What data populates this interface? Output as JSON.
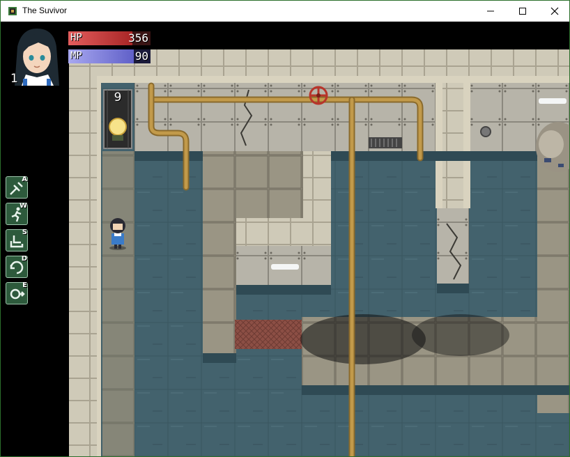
{
  "window": {
    "title": "The Suvivor",
    "controls": [
      "minimize-icon",
      "maximize-icon",
      "close-icon"
    ]
  },
  "hud": {
    "level": "1",
    "hp": {
      "label": "HP",
      "value": "356",
      "fraction": 0.78
    },
    "mp": {
      "label": "MP",
      "value": "90",
      "fraction": 0.8
    }
  },
  "skills": [
    {
      "key": "A",
      "icon": "attack-skill-icon"
    },
    {
      "key": "W",
      "icon": "walk-run-skill-icon"
    },
    {
      "key": "S",
      "icon": "use-skill-icon"
    },
    {
      "key": "D",
      "icon": "cycle-skill-icon"
    },
    {
      "key": "E",
      "icon": "equip-skill-icon"
    }
  ],
  "item_counter": {
    "count": "9",
    "icon": "flashlight-bulb-icon"
  },
  "colors": {
    "hp_bar": "#c93a3a",
    "mp_bar": "#8a8ae0",
    "floor": "#415f6a",
    "wall": "#c9c3b0",
    "pipe": "#b08a3c",
    "valve": "#c0392b"
  }
}
